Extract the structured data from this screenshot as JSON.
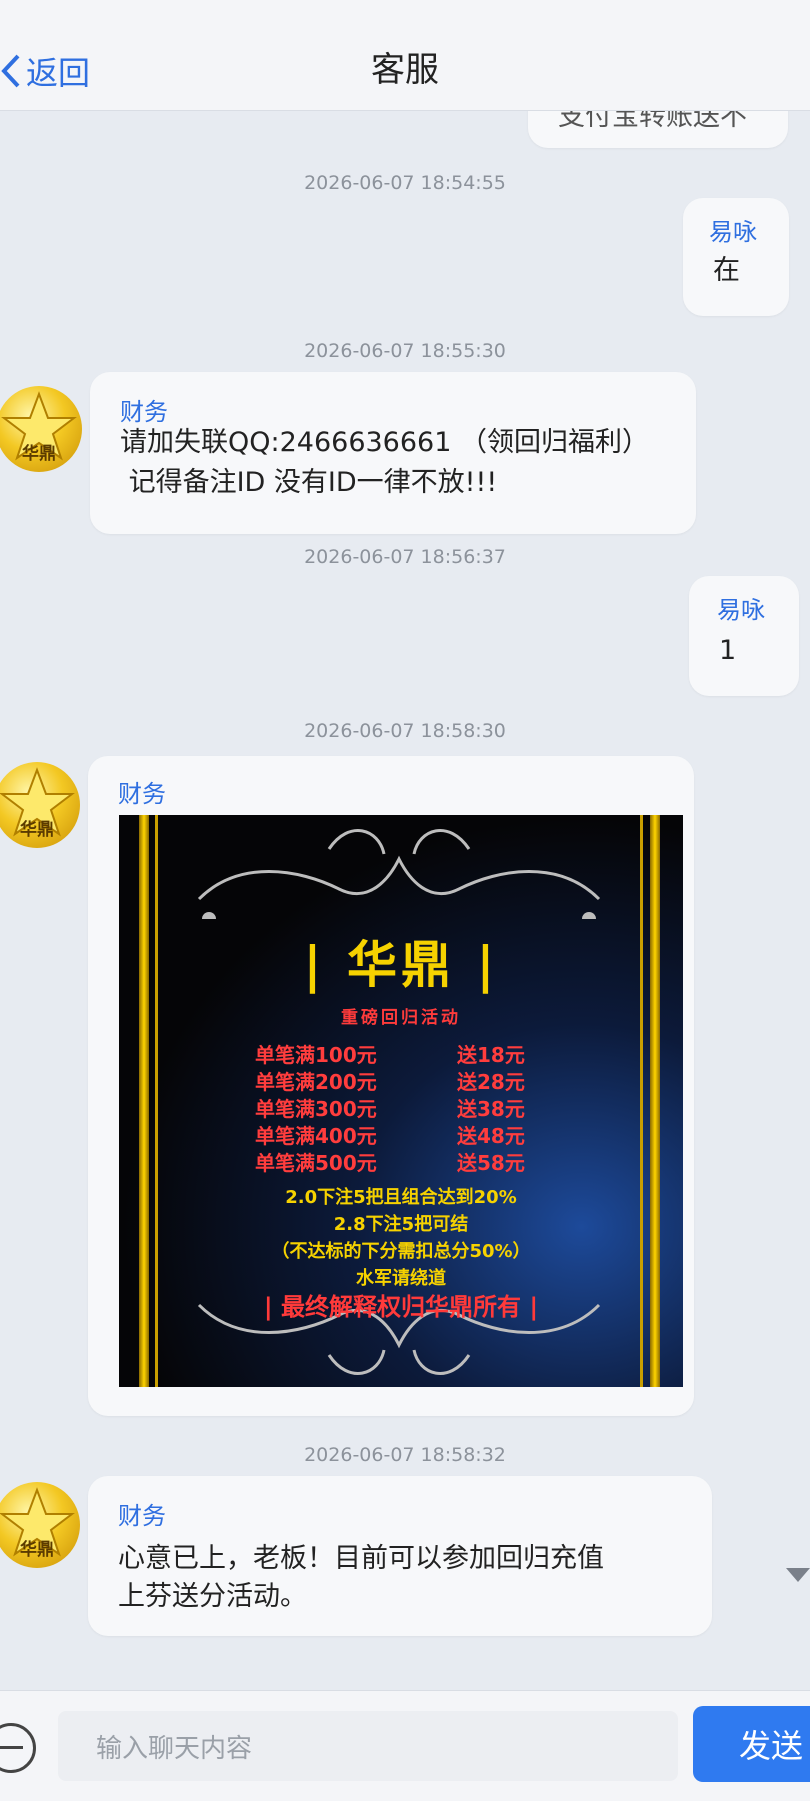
{
  "header": {
    "back_label": "返回",
    "title": "客服"
  },
  "partial_top_message": "支付宝转账送不",
  "messages": [
    {
      "time": "2026-06-07 18:54:55",
      "sender": "易咏",
      "text": "在"
    },
    {
      "time": "2026-06-07 18:55:30",
      "sender": "财务",
      "line1": "请加失联QQ:2466636661 （领回归福利）",
      "line2": " 记得备注ID 没有ID一律不放!!!"
    },
    {
      "time": "2026-06-07 18:56:37",
      "sender": "易咏",
      "text": "1"
    },
    {
      "time": "2026-06-07 18:58:30",
      "sender": "财务"
    },
    {
      "time": "2026-06-07 18:58:32",
      "sender": "财务",
      "line1": "心意已上，老板！目前可以参加回归充值",
      "line2": "上芬送分活动。"
    }
  ],
  "avatar_label": "华鼎",
  "poster": {
    "title": "| 华鼎 |",
    "subtitle": "重磅回归活动",
    "tiers": [
      {
        "deposit": "单笔满100元",
        "bonus": "送18元"
      },
      {
        "deposit": "单笔满200元",
        "bonus": "送28元"
      },
      {
        "deposit": "单笔满300元",
        "bonus": "送38元"
      },
      {
        "deposit": "单笔满400元",
        "bonus": "送48元"
      },
      {
        "deposit": "单笔满500元",
        "bonus": "送58元"
      }
    ],
    "rules": [
      "2.0下注5把且组合达到20%",
      "2.8下注5把可结",
      "（不达标的下分需扣总分50%）",
      "水军请绕道"
    ],
    "final": "| 最终解释权归华鼎所有 |"
  },
  "input": {
    "placeholder": "输入聊天内容",
    "send_label": "发送"
  },
  "colors": {
    "accent": "#2f6fe0",
    "send_button": "#2f7af0",
    "poster_gold": "#f6d200",
    "poster_red": "#ff3d3d"
  }
}
